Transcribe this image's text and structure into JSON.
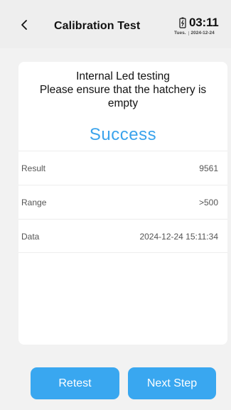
{
  "header": {
    "back_glyph": "<",
    "title": "Calibration Test",
    "time": "03:11",
    "weekday": "Tues.",
    "date": "2024-12-24",
    "battery_icon": "battery-charging-icon"
  },
  "card": {
    "message_line1": "Internal Led testing",
    "message_line2": "Please ensure that the hatchery is",
    "message_line3": "empty",
    "status": "Success",
    "rows": [
      {
        "label": "Result",
        "value": "9561"
      },
      {
        "label": "Range",
        "value": ">500"
      },
      {
        "label": "Data",
        "value": "2024-12-24 15:11:34"
      }
    ]
  },
  "buttons": {
    "retest_label": "Retest",
    "next_label": "Next Step"
  },
  "colors": {
    "accent": "#39a7f0",
    "success_text": "#3aa3ec",
    "background": "#f2f2f2",
    "card": "#ffffff"
  }
}
